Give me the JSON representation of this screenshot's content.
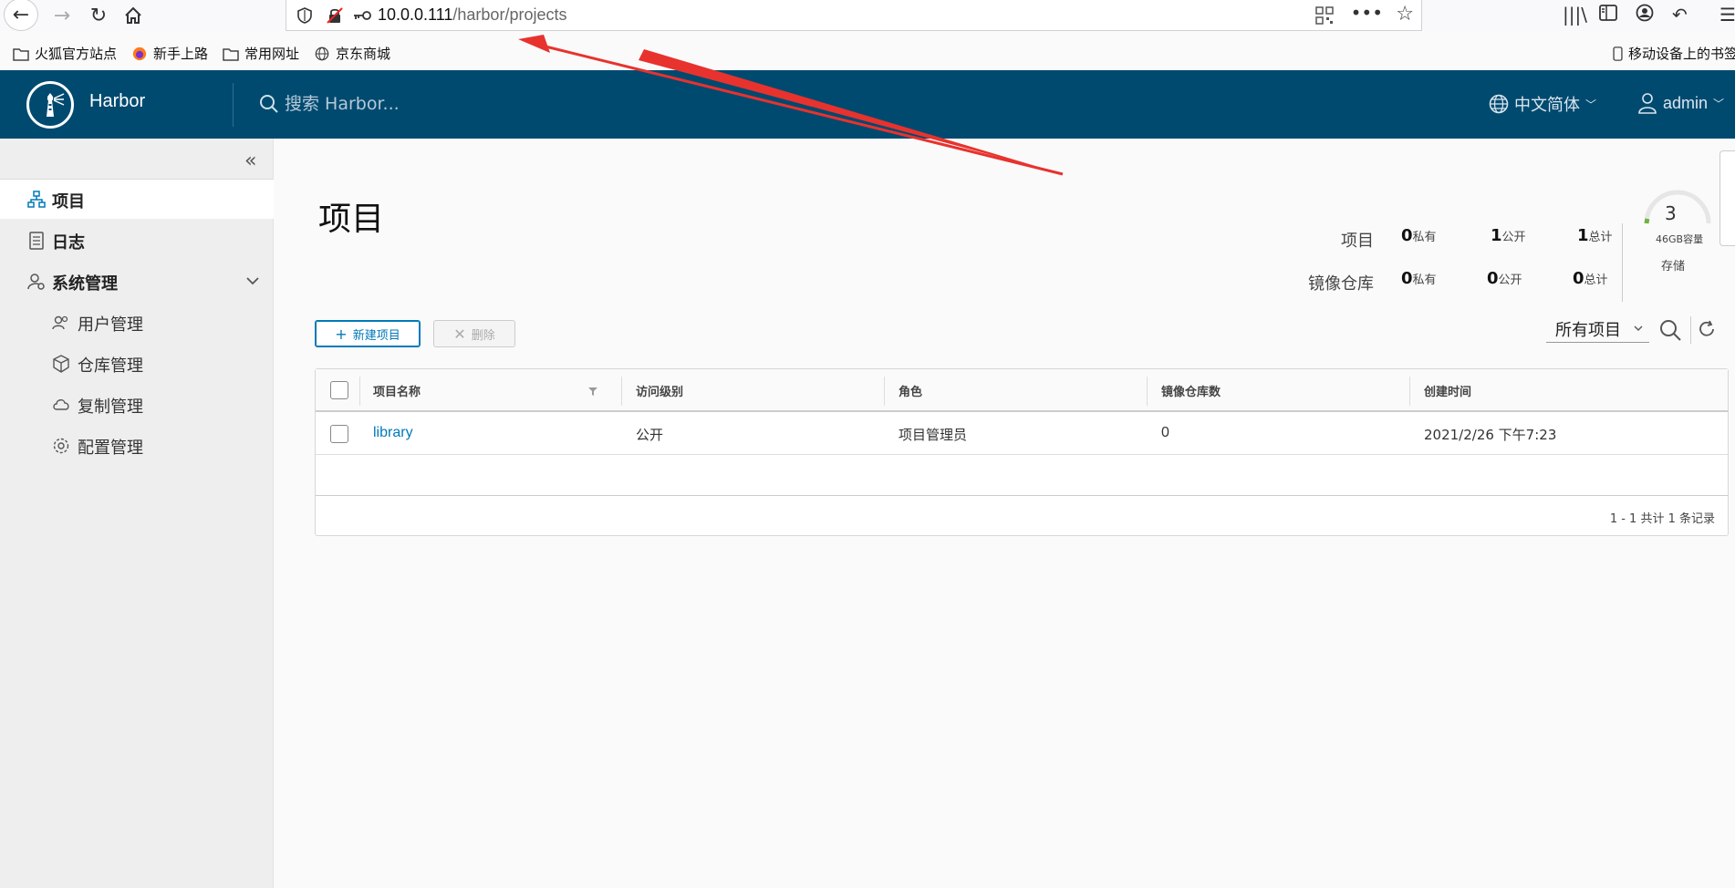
{
  "browser": {
    "url_host": "10.0.0.111",
    "url_path": "/harbor/projects",
    "bookmarks": [
      "火狐官方站点",
      "新手上路",
      "常用网址",
      "京东商城"
    ],
    "mobile_bookmarks": "移动设备上的书签"
  },
  "header": {
    "brand": "Harbor",
    "search_placeholder": "搜索 Harbor...",
    "language": "中文简体",
    "user": "admin"
  },
  "sidebar": {
    "items": [
      {
        "label": "项目",
        "icon": "projects-icon"
      },
      {
        "label": "日志",
        "icon": "logs-icon"
      },
      {
        "label": "系统管理",
        "icon": "admin-icon"
      }
    ],
    "subitems": [
      {
        "label": "用户管理",
        "icon": "users-icon"
      },
      {
        "label": "仓库管理",
        "icon": "registry-icon"
      },
      {
        "label": "复制管理",
        "icon": "replication-icon"
      },
      {
        "label": "配置管理",
        "icon": "config-icon"
      }
    ]
  },
  "main": {
    "title": "项目",
    "stats": {
      "projects_label": "项目",
      "repos_label": "镜像仓库",
      "private_suffix": "私有",
      "public_suffix": "公开",
      "total_suffix": "总计",
      "projects": {
        "private": "0",
        "public": "1",
        "total": "1"
      },
      "repos": {
        "private": "0",
        "public": "0",
        "total": "0"
      },
      "storage_count": "3",
      "storage_capacity": "46GB容量",
      "storage_label": "存储"
    },
    "toolbar": {
      "new_label": "新建项目",
      "delete_label": "删除",
      "filter_value": "所有项目"
    },
    "table": {
      "columns": [
        "项目名称",
        "访问级别",
        "角色",
        "镜像仓库数",
        "创建时间"
      ],
      "rows": [
        {
          "name": "library",
          "access": "公开",
          "role": "项目管理员",
          "repos": "0",
          "created": "2021/2/26 下午7:23"
        }
      ],
      "footer": "1 - 1 共计 1 条记录"
    }
  },
  "colors": {
    "header_bg": "#004a70",
    "accent": "#0079b8",
    "annotation_arrow": "#e8322d"
  }
}
